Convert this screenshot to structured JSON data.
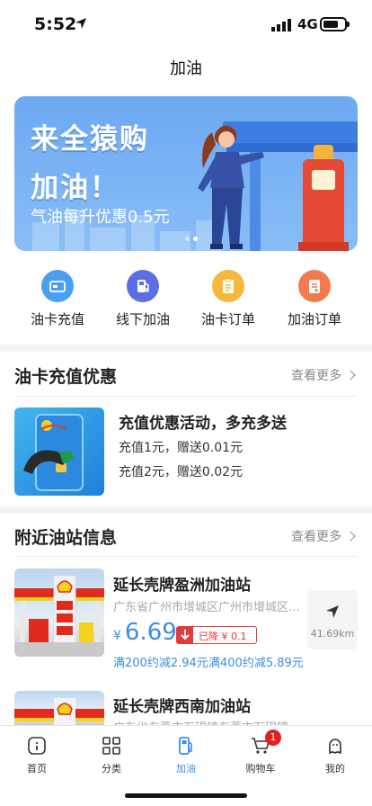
{
  "status": {
    "time": "5:52",
    "network": "4G"
  },
  "nav": {
    "title": "加油"
  },
  "banner": {
    "headline1": "来全猿购",
    "headline2": "加油！",
    "subtitle": "气油每升优惠0.5元"
  },
  "quick_actions": [
    {
      "label": "油卡充值",
      "icon": "card-icon",
      "color": "#4a9ff0"
    },
    {
      "label": "线下加油",
      "icon": "fuel-pump-icon",
      "color": "#5a6ee6"
    },
    {
      "label": "油卡订单",
      "icon": "clipboard-icon",
      "color": "#f5b93a"
    },
    {
      "label": "加油订单",
      "icon": "document-icon",
      "color": "#f27a4e"
    }
  ],
  "recharge_section": {
    "title": "油卡充值优惠",
    "more": "查看更多",
    "promo": {
      "title": "充值优惠活动，多充多送",
      "lines": [
        "充值1元，赠送0.01元",
        "充值2元，赠送0.02元"
      ]
    }
  },
  "stations_section": {
    "title": "附近油站信息",
    "more": "查看更多",
    "stations": [
      {
        "name": "延长壳牌盈洲加油站",
        "address": "广东省广州市增城区广州市增城区朱...",
        "currency": "¥",
        "price": "6.69",
        "drop": "已降 ¥ 0.1",
        "discounts": [
          "满200约减2.94元",
          "满400约减5.89元"
        ],
        "distance": "41.69km"
      },
      {
        "name": "延长壳牌西南加油站",
        "address": "广东省东莞市石碣镇东莞市石碣镇西..."
      }
    ]
  },
  "tabbar": {
    "items": [
      {
        "label": "首页"
      },
      {
        "label": "分类"
      },
      {
        "label": "加油"
      },
      {
        "label": "购物车"
      },
      {
        "label": "我的"
      }
    ],
    "cart_count": "1",
    "active_color": "#3a8ee6"
  }
}
